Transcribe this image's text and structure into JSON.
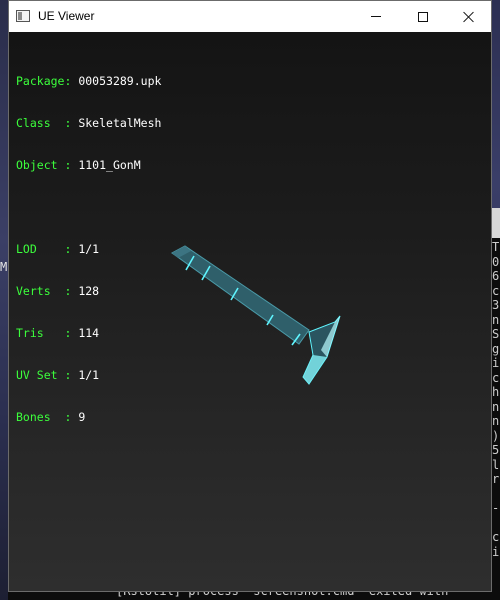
{
  "window": {
    "title": "UE Viewer",
    "buttons": {
      "minimize": "minimize",
      "maximize": "maximize",
      "close": "close"
    }
  },
  "info": {
    "package": {
      "label": "Package",
      "sep": ": ",
      "value": "00053289.upk"
    },
    "class": {
      "label": "Class  ",
      "sep": ": ",
      "value": "SkeletalMesh"
    },
    "object": {
      "label": "Object ",
      "sep": ": ",
      "value": "1101_GonM"
    },
    "lod": {
      "label": "LOD    ",
      "sep": ": ",
      "value": "1/1"
    },
    "verts": {
      "label": "Verts  ",
      "sep": ": ",
      "value": "128"
    },
    "tris": {
      "label": "Tris   ",
      "sep": ": ",
      "value": "114"
    },
    "uvset": {
      "label": "UV Set ",
      "sep": ": ",
      "value": "1/1"
    },
    "bones": {
      "label": "Bones  ",
      "sep": ": ",
      "value": "9"
    }
  },
  "background_console": {
    "left_char": "M",
    "right_column": [
      "T",
      "0",
      "6",
      "c",
      "3",
      "n",
      "S",
      "g",
      "i",
      "c",
      "h",
      "n",
      "n",
      ")",
      "5",
      "l",
      "r",
      "",
      "-",
      "",
      "c",
      "i"
    ],
    "bottom_line": "[RstUtil] process \"screenshot.cmd\" exited with"
  },
  "colors": {
    "info_label": "#3cff3c",
    "info_value": "#ffffff",
    "mesh_body": "#2f5f6a",
    "mesh_edge": "#5ff5ff"
  }
}
